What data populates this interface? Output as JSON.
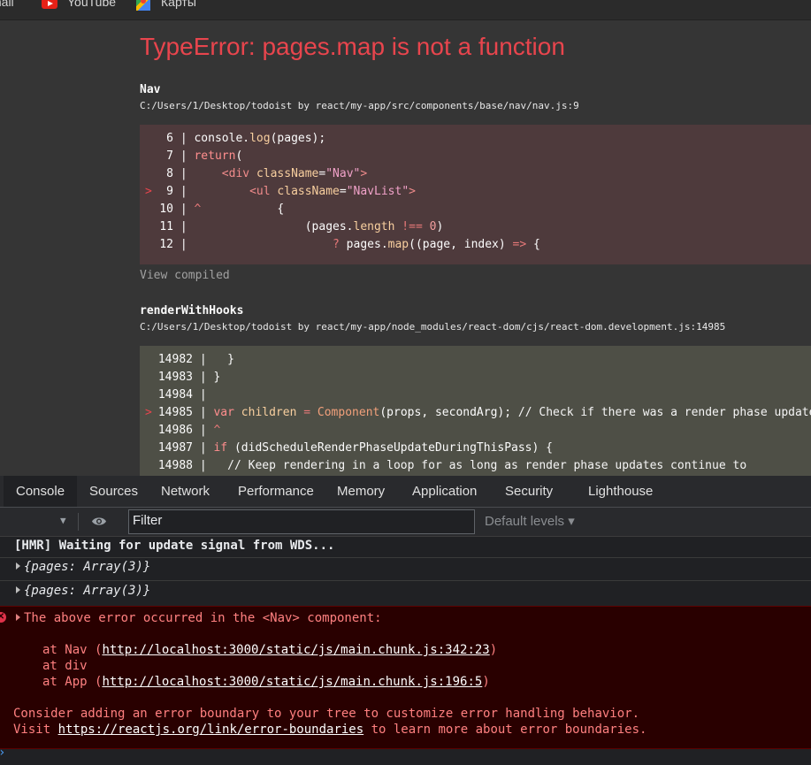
{
  "bookmarks": {
    "items": [
      {
        "label": "mail"
      },
      {
        "label": "YouTube"
      },
      {
        "label": "Карты"
      }
    ]
  },
  "overlay": {
    "title": "TypeError: pages.map is not a function",
    "frame1": {
      "name": "Nav",
      "path": "C:/Users/1/Desktop/todoist by react/my-app/src/components/base/nav/nav.js:9"
    },
    "frame2": {
      "name": "renderWithHooks",
      "path": "C:/Users/1/Desktop/todoist by react/my-app/node_modules/react-dom/cjs/react-dom.development.js:14985"
    },
    "view_compiled": "View compiled"
  },
  "devtools": {
    "tabs": [
      "Console",
      "Sources",
      "Network",
      "Performance",
      "Memory",
      "Application",
      "Security",
      "Lighthouse"
    ],
    "active_tab": "Console",
    "filter_placeholder": "Filter",
    "levels_label": "Default levels ▾",
    "console": {
      "hmr": "[HMR] Waiting for update signal from WDS...",
      "log1": "{pages: Array(3)}",
      "log2": "{pages: Array(3)}",
      "error": {
        "head": "The above error occurred in the <Nav> component:",
        "at1_prefix": "at Nav (",
        "at1_link": "http://localhost:3000/static/js/main.chunk.js:342:23",
        "at1_suffix": ")",
        "at2": "at div",
        "at3_prefix": "at App (",
        "at3_link": "http://localhost:3000/static/js/main.chunk.js:196:5",
        "at3_suffix": ")",
        "hint1": "Consider adding an error boundary to your tree to customize error handling behavior.",
        "hint2_prefix": "Visit ",
        "hint2_link": "https://reactjs.org/link/error-boundaries",
        "hint2_suffix": " to learn more about error boundaries."
      }
    }
  },
  "colors": {
    "error_red": "#e8454d",
    "console_error_bg": "#290000",
    "overlay_bg": "#353535"
  }
}
